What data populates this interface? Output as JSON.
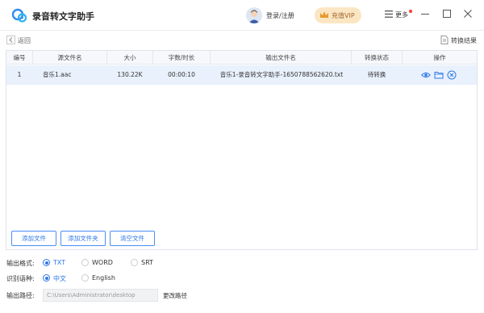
{
  "app": {
    "title": "录音转文字助手"
  },
  "header": {
    "login_label": "登录/注册",
    "vip_label": "充值VIP",
    "more_label": "更多"
  },
  "toolbar": {
    "back_label": "返回",
    "results_label": "转换结果"
  },
  "table": {
    "columns": [
      "编号",
      "源文件名",
      "大小",
      "字数/时长",
      "输出文件名",
      "转换状态",
      "操作"
    ],
    "rows": [
      {
        "index": "1",
        "source": "音乐1.aac",
        "size": "130.22K",
        "duration": "00:00:10",
        "output": "音乐1-录音转文字助手-1650788562620.txt",
        "status": "待转换"
      }
    ]
  },
  "buttons": {
    "add_file": "添加文件",
    "add_folder": "添加文件夹",
    "clear_files": "清空文件"
  },
  "options": {
    "format_label": "输出格式:",
    "formats": [
      "TXT",
      "WORD",
      "SRT"
    ],
    "selected_format": "TXT",
    "language_label": "识别语种:",
    "languages": [
      "中文",
      "English"
    ],
    "selected_language": "中文",
    "path_label": "输出路径:",
    "path_value": "C:\\Users\\Administrator\\desktop",
    "change_path": "更改路径"
  },
  "colors": {
    "accent": "#2f78ea",
    "vip_bg": "#fbe6c3",
    "row_highlight": "#e9f1fc",
    "badge": "#ff3b30"
  }
}
